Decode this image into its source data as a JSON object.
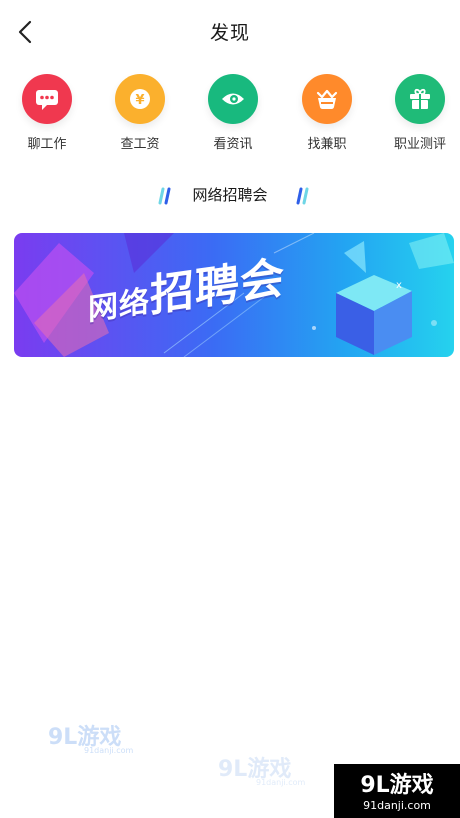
{
  "header": {
    "title": "发现",
    "back_icon": "chevron-left-icon"
  },
  "shortcuts": [
    {
      "label": "聊工作",
      "icon": "chat-bubble-icon",
      "color": "#f0384f"
    },
    {
      "label": "查工资",
      "icon": "yen-coin-icon",
      "color": "#fbb02d"
    },
    {
      "label": "看资讯",
      "icon": "info-eye-icon",
      "color": "#18b97e"
    },
    {
      "label": "找兼职",
      "icon": "basket-icon",
      "color": "#ff8a2b"
    },
    {
      "label": "职业测评",
      "icon": "gift-box-icon",
      "color": "#1fbb78"
    }
  ],
  "section": {
    "title": "网络招聘会"
  },
  "banner": {
    "text_small": "网络",
    "text_big": "招聘会"
  },
  "watermark": {
    "logo": "9L游戏",
    "url": "91danji.com"
  }
}
